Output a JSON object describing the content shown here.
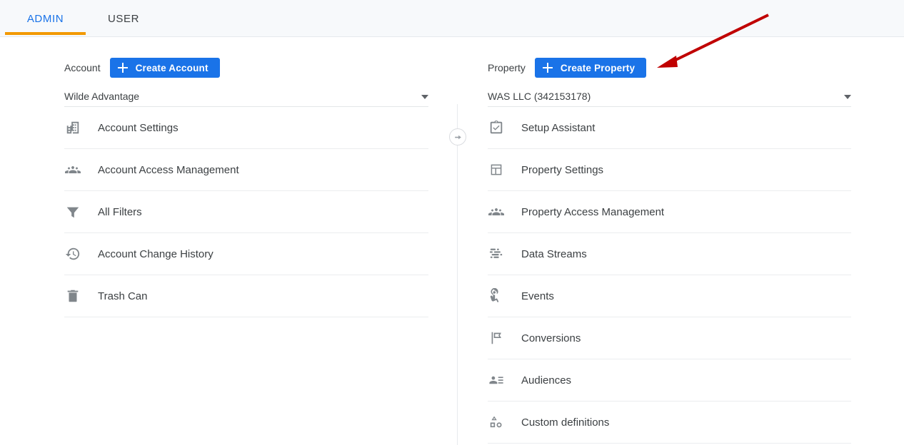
{
  "tabs": [
    {
      "label": "ADMIN",
      "active": true
    },
    {
      "label": "USER",
      "active": false
    }
  ],
  "colors": {
    "accent_blue": "#1a73e8",
    "active_tab_underline": "#f29900",
    "annotation_red": "#c00000",
    "header_background": "#f7f9fb",
    "icon_gray": "#80868b",
    "text_primary": "#3c4043"
  },
  "account_column": {
    "header_label": "Account",
    "create_button_label": "Create Account",
    "create_button_icon": "plus-icon",
    "selected_account": "Wilde Advantage",
    "selector_icon": "chevron-down-icon",
    "items": [
      {
        "label": "Account Settings",
        "icon": "building-icon"
      },
      {
        "label": "Account Access Management",
        "icon": "people-icon"
      },
      {
        "label": "All Filters",
        "icon": "filter-icon"
      },
      {
        "label": "Account Change History",
        "icon": "history-icon"
      },
      {
        "label": "Trash Can",
        "icon": "trash-icon"
      }
    ]
  },
  "property_column": {
    "header_label": "Property",
    "create_button_label": "Create Property",
    "create_button_icon": "plus-icon",
    "selected_property": "WAS LLC (342153178)",
    "selector_icon": "chevron-down-icon",
    "items": [
      {
        "label": "Setup Assistant",
        "icon": "clipboard-check-icon"
      },
      {
        "label": "Property Settings",
        "icon": "layout-icon"
      },
      {
        "label": "Property Access Management",
        "icon": "people-icon"
      },
      {
        "label": "Data Streams",
        "icon": "data-streams-icon"
      },
      {
        "label": "Events",
        "icon": "tap-icon"
      },
      {
        "label": "Conversions",
        "icon": "flag-icon"
      },
      {
        "label": "Audiences",
        "icon": "audience-icon"
      },
      {
        "label": "Custom definitions",
        "icon": "shapes-icon"
      }
    ]
  },
  "divider": {
    "icon": "arrow-right-circle-icon"
  },
  "annotation": {
    "icon": "red-arrow-annotation",
    "points_to": "Create Property"
  }
}
